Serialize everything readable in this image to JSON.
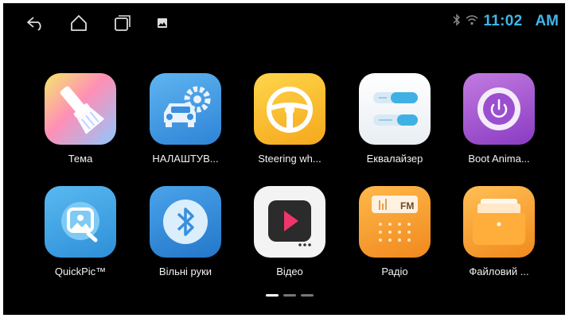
{
  "status_bar": {
    "time": "11:02",
    "ampm": "AM",
    "icons": [
      "back-icon",
      "home-icon",
      "recents-icon",
      "gallery-icon",
      "bluetooth-icon",
      "wifi-icon"
    ],
    "accent_color": "#3fb6e8"
  },
  "apps": [
    {
      "label": "Тема",
      "icon": "paint-brush-icon"
    },
    {
      "label": "НАЛАШТУВ...",
      "icon": "car-settings-icon"
    },
    {
      "label": "Steering wh...",
      "icon": "steering-wheel-icon"
    },
    {
      "label": "Еквалайзер",
      "icon": "equalizer-icon"
    },
    {
      "label": "Boot Anima...",
      "icon": "power-icon"
    },
    {
      "label": "QuickPic™",
      "icon": "quickpic-icon"
    },
    {
      "label": "Вільні руки",
      "icon": "bluetooth-icon"
    },
    {
      "label": "Відео",
      "icon": "video-play-icon"
    },
    {
      "label": "Радіо",
      "icon": "radio-icon"
    },
    {
      "label": "Файловий ...",
      "icon": "folder-icon"
    }
  ],
  "radio_tile_text": "FM",
  "pager": {
    "pages": 3,
    "current": 1
  }
}
